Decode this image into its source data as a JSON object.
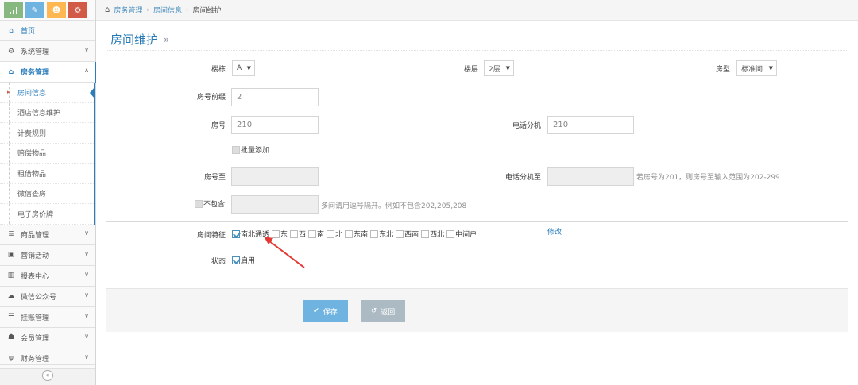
{
  "shortcuts": [
    {
      "icon": "chart-icon",
      "color": "#87b87f",
      "glyph": "▴"
    },
    {
      "icon": "pencil-icon",
      "color": "#6fb3e0",
      "glyph": "✎"
    },
    {
      "icon": "users-icon",
      "color": "#ffb752",
      "glyph": "☻"
    },
    {
      "icon": "cogs-icon",
      "color": "#d15b47",
      "glyph": "⚙"
    }
  ],
  "sidebar": {
    "home": "首页",
    "system": "系统管理",
    "rooms": "房务管理",
    "sub_items": [
      "房间信息",
      "酒店信息维护",
      "计费规则",
      "赔偿物品",
      "租借物品",
      "微信查房",
      "电子房价牌"
    ],
    "more": [
      "商品管理",
      "营销活动",
      "报表中心",
      "微信公众号",
      "挂账管理",
      "会员管理",
      "财务管理"
    ]
  },
  "breadcrumb": {
    "l1": "房务管理",
    "l2": "房间信息",
    "l3": "房间维护"
  },
  "page": {
    "title": "房间维护",
    "arrow": "»"
  },
  "form": {
    "building_label": "楼栋",
    "building_value": "A",
    "floor_label": "楼层",
    "floor_value": "2层",
    "roomtype_label": "房型",
    "roomtype_value": "标准间",
    "prefix_label": "房号前缀",
    "prefix_value": "2",
    "roomno_label": "房号",
    "roomno_value": "210",
    "ext_label": "电话分机",
    "ext_value": "210",
    "batch_label": "批量添加",
    "roomno_to_label": "房号至",
    "ext_to_label": "电话分机至",
    "ext_to_hint": "若房号为201，则房号至输入范围为202-299",
    "exclude_label": "不包含",
    "exclude_hint": "多间请用逗号隔开。例如不包含202,205,208",
    "features_label": "房间特征",
    "features": [
      {
        "text": "南北通透",
        "checked": true
      },
      {
        "text": "东",
        "checked": false
      },
      {
        "text": "西",
        "checked": false
      },
      {
        "text": "南",
        "checked": false
      },
      {
        "text": "北",
        "checked": false
      },
      {
        "text": "东南",
        "checked": false
      },
      {
        "text": "东北",
        "checked": false
      },
      {
        "text": "西南",
        "checked": false
      },
      {
        "text": "西北",
        "checked": false
      },
      {
        "text": "中间户",
        "checked": false
      }
    ],
    "modify_link": "修改",
    "status_label": "状态",
    "enabled_label": "启用"
  },
  "actions": {
    "save": "保存",
    "back": "返回"
  },
  "colors": {
    "accent": "#2b7dbc",
    "annotation_arrow": "#e53935"
  }
}
